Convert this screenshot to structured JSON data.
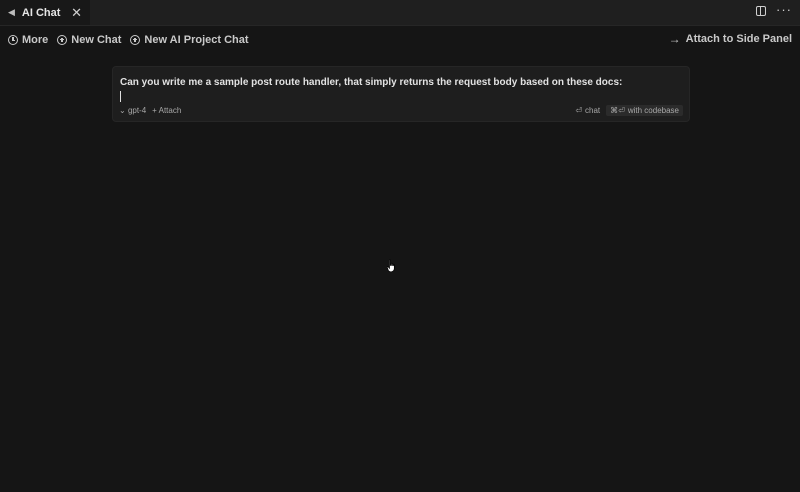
{
  "tab": {
    "title": "AI Chat",
    "close_glyph": "✕"
  },
  "toolbar": {
    "more_label": "More",
    "new_chat_label": "New Chat",
    "new_project_chat_label": "New AI Project Chat",
    "attach_side_label": "Attach to Side Panel"
  },
  "chat_input": {
    "value": "Can you write me a sample post route handler, that simply returns the request body based on these docs:",
    "model": "gpt-4",
    "attach_label": "Attach",
    "chat_shortcut": "⏎",
    "chat_label": "chat",
    "codebase_shortcut": "⌘⏎",
    "codebase_label": "with codebase"
  },
  "icons": {
    "tab_indicator": "triangle-left-icon",
    "split": "split-editor-icon",
    "more_actions": "ellipsis-icon",
    "history": "history-icon",
    "add": "plus-circle-icon",
    "arrow": "arrow-right-icon",
    "pointer": "hand-pointer-icon"
  },
  "colors": {
    "background": "#151515",
    "tabbar": "#1f1f1f",
    "input_bg": "#1e1e1e",
    "text": "#e2e2e2"
  }
}
